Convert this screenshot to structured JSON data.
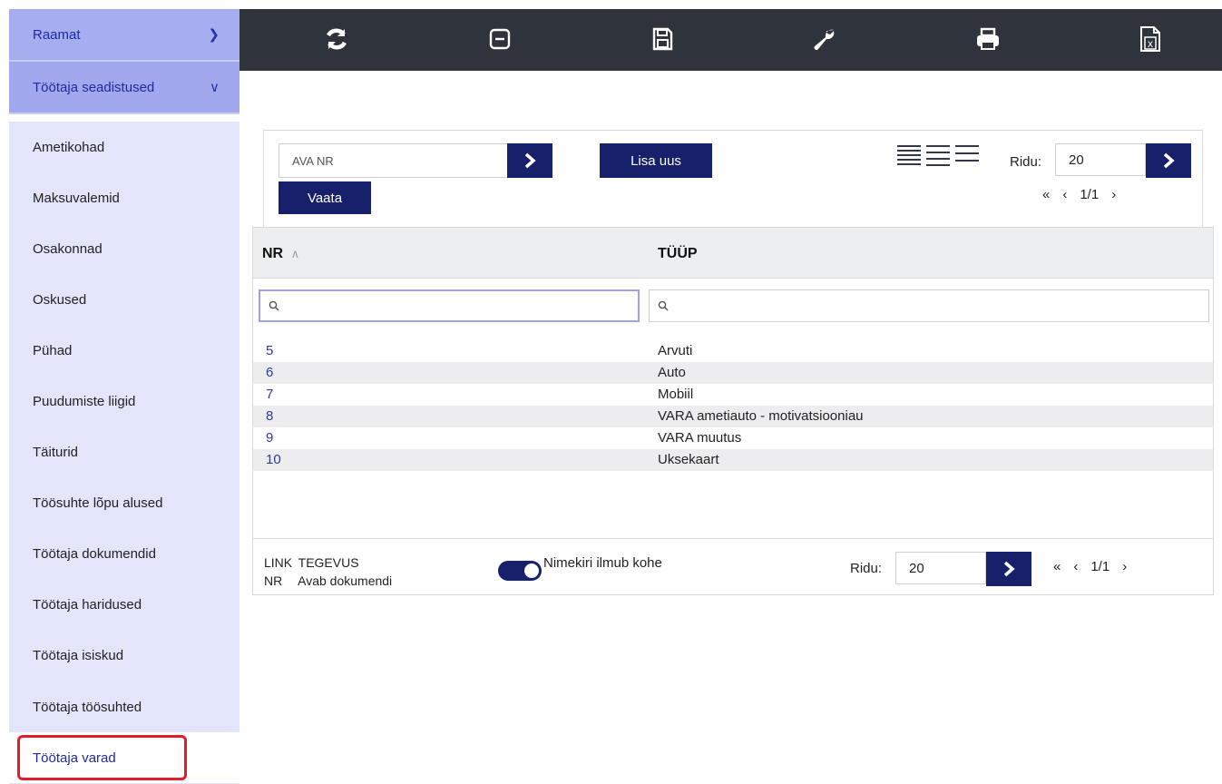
{
  "sidebar": {
    "sections": [
      {
        "label": "Raamat",
        "state": "collapsed"
      },
      {
        "label": "Töötaja seadistused",
        "state": "expanded"
      }
    ],
    "items": [
      {
        "label": "Ametikohad"
      },
      {
        "label": "Maksuvalemid"
      },
      {
        "label": "Osakonnad"
      },
      {
        "label": "Oskused"
      },
      {
        "label": "Pühad"
      },
      {
        "label": "Puudumiste liigid"
      },
      {
        "label": "Täiturid"
      },
      {
        "label": "Töösuhte lõpu alused"
      },
      {
        "label": "Töötaja dokumendid"
      },
      {
        "label": "Töötaja haridused"
      },
      {
        "label": "Töötaja isiskud"
      },
      {
        "label": "Töötaja töösuhted"
      },
      {
        "label": "Töötaja varad",
        "active": true
      }
    ]
  },
  "toolbar": {
    "icons": [
      "refresh-icon",
      "minus-box-icon",
      "save-icon",
      "wrench-icon",
      "print-icon",
      "excel-export-icon"
    ]
  },
  "filters": {
    "open_nr_placeholder": "AVA NR",
    "add_new_label": "Lisa uus",
    "view_label": "Vaata",
    "rows_label": "Ridu:",
    "rows_value": "20",
    "page_text": "1/1"
  },
  "table": {
    "columns": [
      "NR",
      "TÜÜP"
    ],
    "sort_indicator": "^",
    "rows": [
      {
        "nr": "5",
        "type": "Arvuti"
      },
      {
        "nr": "6",
        "type": "Auto"
      },
      {
        "nr": "7",
        "type": "Mobiil"
      },
      {
        "nr": "8",
        "type": "VARA ametiauto - motivatsiooniau"
      },
      {
        "nr": "9",
        "type": "VARA muutus"
      },
      {
        "nr": "10",
        "type": "Uksekaart"
      }
    ]
  },
  "footer": {
    "legend_head_key": "LINK",
    "legend_head_val": "TEGEVUS",
    "legend_row_key": "NR",
    "legend_row_val": "Avab dokumendi",
    "toggle_label": "Nimekiri ilmub kohe",
    "toggle_on": true,
    "rows_label": "Ridu:",
    "rows_value": "20",
    "page_text": "1/1"
  },
  "colors": {
    "accent": "#16206b",
    "sidebar_bg": "#e3e6fb",
    "sidebar_header": "#a7aef0",
    "toolbar_bg": "#2f333b",
    "highlight_border": "#e11d2b"
  }
}
